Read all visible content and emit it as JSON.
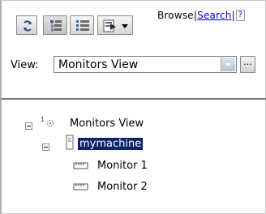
{
  "toolbar": {
    "refresh_icon": "refresh-icon",
    "tree_view_icon": "tree-view-icon",
    "list_view_icon": "list-view-icon",
    "menu_icon": "menu-dropdown-icon"
  },
  "links": {
    "browse": "Browse",
    "separator": "|",
    "search": "Search",
    "help": "?"
  },
  "view": {
    "label": "View:",
    "selected": "Monitors View",
    "more_label": "..."
  },
  "tree": {
    "root": {
      "label": "Monitors View",
      "icon": "monitors-view-icon",
      "expanded": true
    },
    "machine": {
      "label": "mymachine",
      "icon": "machine-icon",
      "expanded": true,
      "selected": true
    },
    "monitors": [
      {
        "label": "Monitor 1",
        "icon": "monitor-icon"
      },
      {
        "label": "Monitor 2",
        "icon": "monitor-icon"
      }
    ]
  },
  "colors": {
    "selection_bg": "#0a246a",
    "link": "#0000cc"
  }
}
